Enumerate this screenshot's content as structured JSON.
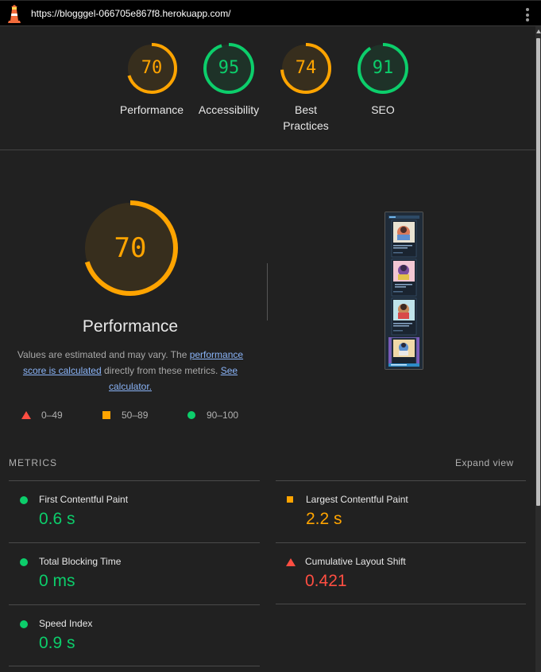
{
  "topbar": {
    "url": "https://blogggel-066705e867f8.herokuapp.com/",
    "logo_icon": "lighthouse-icon",
    "menu_icon": "kebab-menu-icon"
  },
  "gauges": [
    {
      "label": "Performance",
      "score": "70",
      "fraction": 0.7,
      "color": "#ffa400"
    },
    {
      "label": "Accessibility",
      "score": "95",
      "fraction": 0.95,
      "color": "#0cce6b"
    },
    {
      "label": "Best Practices",
      "score": "74",
      "fraction": 0.74,
      "color": "#ffa400"
    },
    {
      "label": "SEO",
      "score": "91",
      "fraction": 0.91,
      "color": "#0cce6b"
    }
  ],
  "performance": {
    "score": "70",
    "fraction": 0.7,
    "title": "Performance",
    "desc_prefix": "Values are estimated and may vary. The ",
    "desc_link1": "performance score is calculated",
    "desc_middle": " directly from these metrics. ",
    "desc_link2": "See calculator."
  },
  "legend": [
    {
      "range": "0–49",
      "icon": "triangle-fail-icon",
      "color": "#ff4e42"
    },
    {
      "range": "50–89",
      "icon": "square-average-icon",
      "color": "#ffa400"
    },
    {
      "range": "90–100",
      "icon": "circle-pass-icon",
      "color": "#0cce6b"
    }
  ],
  "metrics": {
    "title": "METRICS",
    "expand_label": "Expand view",
    "items": [
      {
        "label": "First Contentful Paint",
        "value": "0.6 s",
        "status": "pass",
        "color": "#0cce6b"
      },
      {
        "label": "Largest Contentful Paint",
        "value": "2.2 s",
        "status": "average",
        "color": "#ffa400"
      },
      {
        "label": "Total Blocking Time",
        "value": "0 ms",
        "status": "pass",
        "color": "#0cce6b"
      },
      {
        "label": "Cumulative Layout Shift",
        "value": "0.421",
        "status": "fail",
        "color": "#ff4e42"
      },
      {
        "label": "Speed Index",
        "value": "0.9 s",
        "status": "pass",
        "color": "#0cce6b"
      }
    ]
  },
  "colors": {
    "background": "#212121",
    "pass": "#0cce6b",
    "average": "#ffa400",
    "fail": "#ff4e42",
    "link": "#8ab4f8"
  }
}
